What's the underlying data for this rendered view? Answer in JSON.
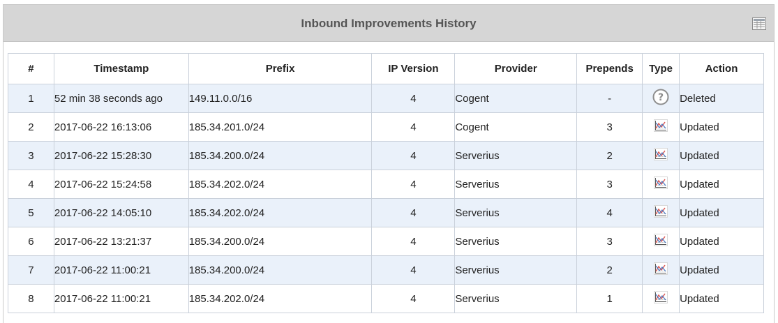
{
  "panel": {
    "title": "Inbound Improvements History",
    "export_icon": "spreadsheet-icon"
  },
  "table": {
    "headers": {
      "num": "#",
      "timestamp": "Timestamp",
      "prefix": "Prefix",
      "ip_version": "IP Version",
      "provider": "Provider",
      "prepends": "Prepends",
      "type": "Type",
      "action": "Action"
    },
    "rows": [
      {
        "num": "1",
        "timestamp": "52 min 38 seconds ago",
        "prefix": "149.11.0.0/16",
        "ip_version": "4",
        "provider": "Cogent",
        "prepends": "-",
        "type": "question-icon",
        "action": "Deleted"
      },
      {
        "num": "2",
        "timestamp": "2017-06-22 16:13:06",
        "prefix": "185.34.201.0/24",
        "ip_version": "4",
        "provider": "Cogent",
        "prepends": "3",
        "type": "chart-icon",
        "action": "Updated"
      },
      {
        "num": "3",
        "timestamp": "2017-06-22 15:28:30",
        "prefix": "185.34.200.0/24",
        "ip_version": "4",
        "provider": "Serverius",
        "prepends": "2",
        "type": "chart-icon",
        "action": "Updated"
      },
      {
        "num": "4",
        "timestamp": "2017-06-22 15:24:58",
        "prefix": "185.34.202.0/24",
        "ip_version": "4",
        "provider": "Serverius",
        "prepends": "3",
        "type": "chart-icon",
        "action": "Updated"
      },
      {
        "num": "5",
        "timestamp": "2017-06-22 14:05:10",
        "prefix": "185.34.202.0/24",
        "ip_version": "4",
        "provider": "Serverius",
        "prepends": "4",
        "type": "chart-icon",
        "action": "Updated"
      },
      {
        "num": "6",
        "timestamp": "2017-06-22 13:21:37",
        "prefix": "185.34.200.0/24",
        "ip_version": "4",
        "provider": "Serverius",
        "prepends": "3",
        "type": "chart-icon",
        "action": "Updated"
      },
      {
        "num": "7",
        "timestamp": "2017-06-22 11:00:21",
        "prefix": "185.34.200.0/24",
        "ip_version": "4",
        "provider": "Serverius",
        "prepends": "2",
        "type": "chart-icon",
        "action": "Updated"
      },
      {
        "num": "8",
        "timestamp": "2017-06-22 11:00:21",
        "prefix": "185.34.202.0/24",
        "ip_version": "4",
        "provider": "Serverius",
        "prepends": "1",
        "type": "chart-icon",
        "action": "Updated"
      }
    ]
  },
  "colors": {
    "header_bg": "#d6d6d6",
    "row_alt_bg": "#eaf1fa",
    "border": "#c9d0da"
  }
}
